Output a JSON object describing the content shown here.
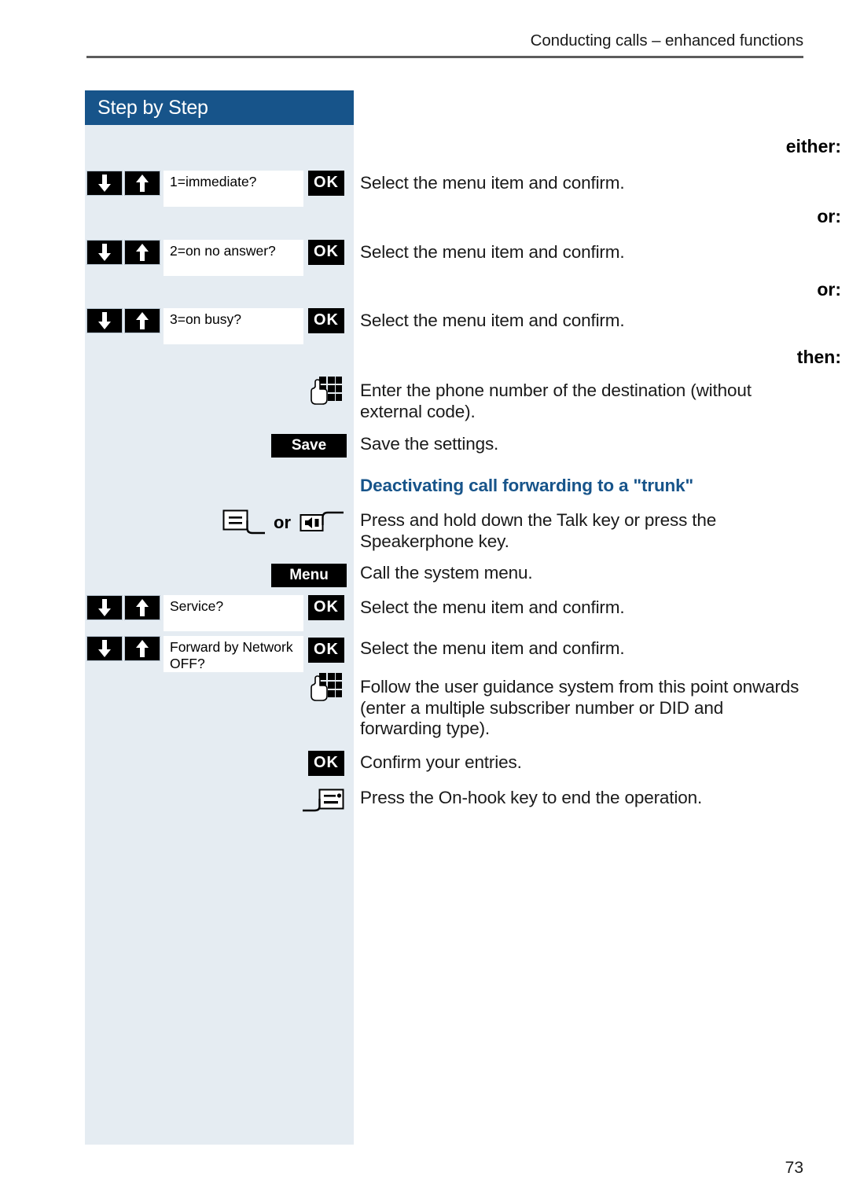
{
  "header": {
    "running_head": "Conducting calls – enhanced functions"
  },
  "sidebar": {
    "title": "Step by Step",
    "connectors": {
      "either": "either:",
      "or_1": "or:",
      "or_2": "or:",
      "then": "then:"
    },
    "keys": {
      "ok": "OK",
      "save": "Save",
      "menu": "Menu",
      "or": "or"
    }
  },
  "steps": [
    {
      "id": "immediate",
      "display": "1=immediate?",
      "key": "OK",
      "instruction": "Select the menu item and confirm."
    },
    {
      "id": "on-no-answer",
      "display": "2=on no answer?",
      "key": "OK",
      "instruction": "Select the menu item and confirm."
    },
    {
      "id": "on-busy",
      "display": "3=on busy?",
      "key": "OK",
      "instruction": "Select the menu item and confirm."
    },
    {
      "id": "enter-number",
      "display": "",
      "key": "",
      "instruction": "Enter the phone number of the destination (without external code)."
    },
    {
      "id": "save",
      "display": "",
      "key": "Save",
      "instruction": "Save the settings."
    }
  ],
  "section": {
    "heading": "Deactivating call forwarding to a \"trunk\"",
    "steps": [
      {
        "id": "talk-or-speaker",
        "instruction": "Press and hold down the Talk key or press the Speakerphone key."
      },
      {
        "id": "call-system-menu",
        "key": "Menu",
        "instruction": "Call the system menu."
      },
      {
        "id": "service",
        "display": "Service?",
        "key": "OK",
        "instruction": "Select the menu item and confirm."
      },
      {
        "id": "forward-by-network-off",
        "display": "Forward by Network OFF?",
        "key": "OK",
        "instruction": "Select the menu item and confirm."
      },
      {
        "id": "follow-guidance",
        "instruction": "Follow the user guidance system from this point onwards (enter a multiple subscriber number or DID and forwarding type)."
      },
      {
        "id": "confirm-entries",
        "key": "OK",
        "instruction": "Confirm your entries."
      },
      {
        "id": "on-hook",
        "instruction": "Press the On-hook key to end the operation."
      }
    ]
  },
  "footer": {
    "page_number": "73"
  },
  "colors": {
    "accent_blue": "#17548a",
    "sidebar_bg": "#e5ecf2",
    "key_black": "#000000",
    "rule_gray": "#5c5c5c"
  }
}
